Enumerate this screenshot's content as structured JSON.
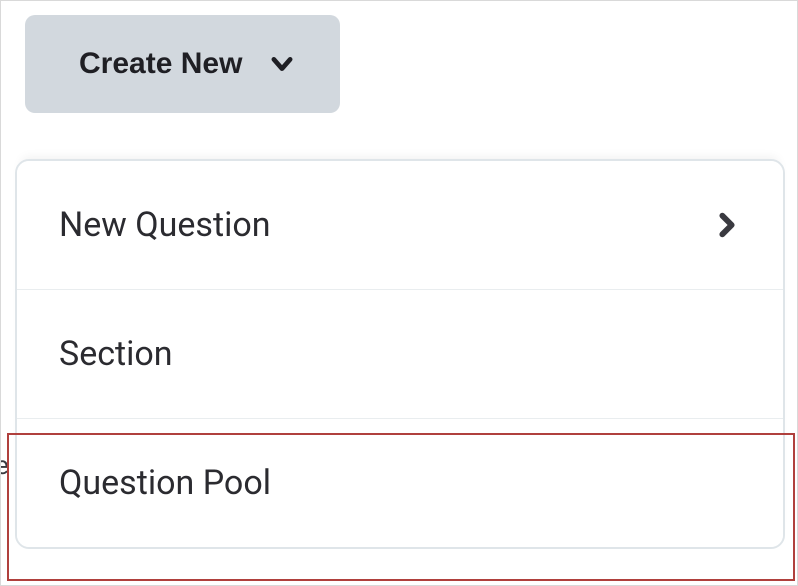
{
  "button": {
    "create_new_label": "Create New"
  },
  "menu": {
    "items": [
      {
        "label": "New Question",
        "has_submenu": true
      },
      {
        "label": "Section",
        "has_submenu": false
      },
      {
        "label": "Question Pool",
        "has_submenu": false
      }
    ]
  },
  "colors": {
    "button_bg": "#d2d8de",
    "panel_border": "#dfe5e9",
    "highlight_border": "#b0403d",
    "text": "#2b2b30"
  }
}
